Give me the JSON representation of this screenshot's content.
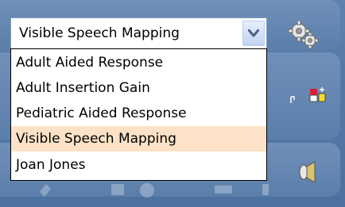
{
  "combo": {
    "value": "Visible Speech Mapping"
  },
  "dropdown": {
    "items": [
      {
        "label": "Adult Aided Response"
      },
      {
        "label": "Adult Insertion Gain"
      },
      {
        "label": "Pediatric Aided Response"
      },
      {
        "label": "Visible Speech Mapping"
      },
      {
        "label": "Joan Jones"
      }
    ],
    "selected_index": 3
  },
  "colors": {
    "panel_bg": "#5578a6",
    "selection_bg": "#fde2c7"
  },
  "icons": {
    "settings": "gear-icon",
    "flag": "flag-icon",
    "speaker": "speaker-icon",
    "dropdown_arrow": "chevron-down-icon"
  }
}
